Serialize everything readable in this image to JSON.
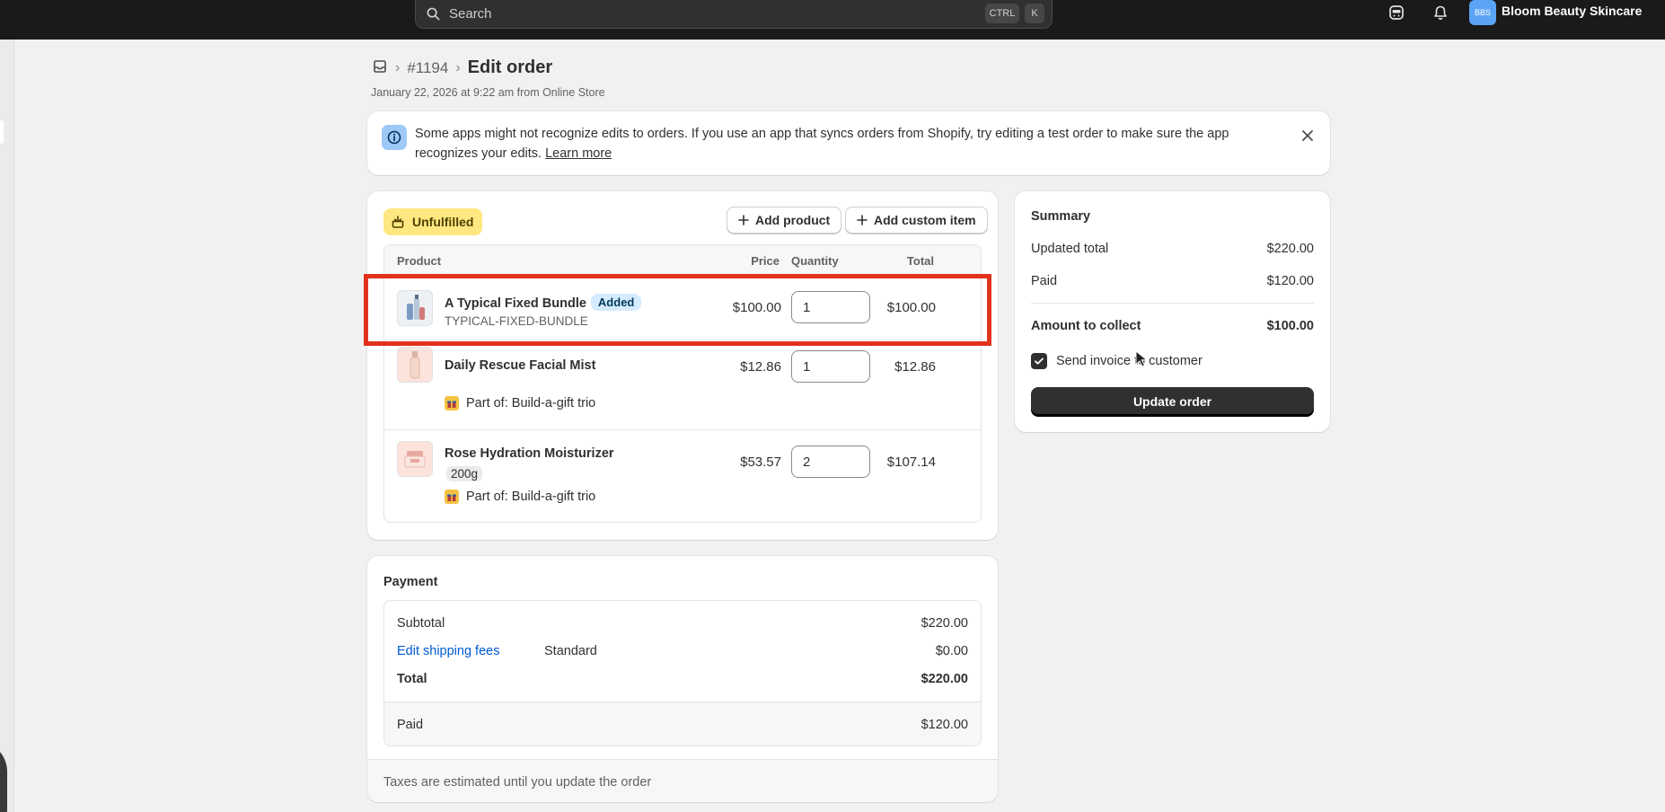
{
  "topbar": {
    "search_placeholder": "Search",
    "shortcut_ctrl": "CTRL",
    "shortcut_k": "K",
    "avatar_initials": "BBS",
    "store_name": "Bloom Beauty Skincare"
  },
  "header": {
    "order_number": "#1194",
    "title": "Edit order",
    "subtitle": "January 22, 2026 at 9:22 am from Online Store"
  },
  "banner": {
    "text": "Some apps might not recognize edits to orders. If you use an app that syncs orders from Shopify, try editing a test order to make sure the app recognizes your edits.",
    "link": "Learn more"
  },
  "items": {
    "status_badge": "Unfulfilled",
    "add_product": "Add product",
    "add_custom_item": "Add custom item",
    "columns": {
      "product": "Product",
      "price": "Price",
      "quantity": "Quantity",
      "total": "Total"
    },
    "rows": [
      {
        "name": "A Typical Fixed Bundle",
        "badge": "Added",
        "sku": "TYPICAL-FIXED-BUNDLE",
        "price": "$100.00",
        "quantity": "1",
        "total": "$100.00"
      },
      {
        "name": "Daily Rescue Facial Mist",
        "part_of": "Part of: Build-a-gift trio",
        "price": "$12.86",
        "quantity": "1",
        "total": "$12.86"
      },
      {
        "name": "Rose Hydration Moisturizer",
        "variant": "200g",
        "part_of": "Part of: Build-a-gift trio",
        "price": "$53.57",
        "quantity": "2",
        "total": "$107.14"
      }
    ]
  },
  "summary": {
    "title": "Summary",
    "updated_total_label": "Updated total",
    "updated_total_value": "$220.00",
    "paid_label": "Paid",
    "paid_value": "$120.00",
    "amount_to_collect_label": "Amount to collect",
    "amount_to_collect_value": "$100.00",
    "send_invoice_label": "Send invoice to customer",
    "send_invoice_checked": true,
    "update_button": "Update order"
  },
  "payment": {
    "title": "Payment",
    "subtotal_label": "Subtotal",
    "subtotal_value": "$220.00",
    "shipping_link": "Edit shipping fees",
    "shipping_method": "Standard",
    "shipping_value": "$0.00",
    "total_label": "Total",
    "total_value": "$220.00",
    "paid_label": "Paid",
    "paid_value": "$120.00",
    "tax_note": "Taxes are estimated until you update the order"
  },
  "colors": {
    "highlight": "#e1321d",
    "topbar": "#1a1a1a",
    "unfulfilled_badge": "#ffe781",
    "added_badge": "#d5ebff",
    "link": "#005bd3",
    "primary_button": "#303030"
  }
}
